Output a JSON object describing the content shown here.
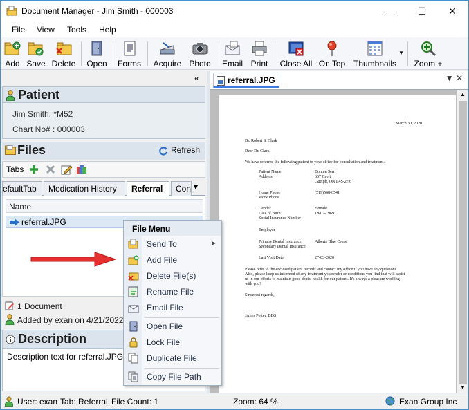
{
  "window": {
    "title": "Document Manager - Jim Smith - 000003",
    "controls": {
      "minimize": "—",
      "maximize": "☐",
      "close": "✕"
    }
  },
  "menu": [
    "File",
    "View",
    "Tools",
    "Help"
  ],
  "toolbar": {
    "add": "Add",
    "save": "Save",
    "delete": "Delete",
    "open": "Open",
    "forms": "Forms",
    "acquire": "Acquire",
    "photo": "Photo",
    "email": "Email",
    "print": "Print",
    "close_all": "Close All",
    "on_top": "On Top",
    "thumbnails": "Thumbnails",
    "zoom": "Zoom +"
  },
  "patient": {
    "header": "Patient",
    "name_line": "Jim Smith, *M52",
    "chart_line": "Chart No# : 000003"
  },
  "files": {
    "header": "Files",
    "refresh": "Refresh",
    "tabs_label": "Tabs",
    "tabs": [
      "efaultTab",
      "Medication History",
      "Referral",
      "Con"
    ],
    "column_name": "Name",
    "file": "referral.JPG",
    "doc_count": "1 Document",
    "added_by": "Added by exan on 4/21/2022"
  },
  "description": {
    "header": "Description",
    "text": "Description text for referral.JPG..."
  },
  "context_menu": {
    "title": "File Menu",
    "items": [
      "Send To",
      "Add File",
      "Delete File(s)",
      "Rename File",
      "Email File",
      "Open File",
      "Lock File",
      "Duplicate File",
      "Copy File Path"
    ]
  },
  "viewer": {
    "tab": "referral.JPG",
    "letter": {
      "date": "March 30, 2020",
      "to": "Dr. Robert S. Clark",
      "greeting": "Dear Dr. Clark,",
      "intro": "We have referred the following patient to your office for consultation and treatment.",
      "fields": [
        [
          "Patient Name",
          "Bonnie Serr"
        ],
        [
          "Address",
          "657 Croft"
        ],
        [
          "",
          "Guelph, ON  L4S-2H6"
        ],
        [
          "Home Phone",
          "(519)568-6541"
        ],
        [
          "Work Phone",
          ""
        ],
        [
          "Gender",
          "Female"
        ],
        [
          "Date of Birth",
          "19-02-1969"
        ],
        [
          "Social Insurance Number",
          ""
        ],
        [
          "Employer",
          ""
        ],
        [
          "Primary Dental Insurance",
          "Alberta Blue Cross"
        ],
        [
          "Secondary Dental Insurance",
          ""
        ],
        [
          "Last Visit Date",
          "27-03-2020"
        ]
      ],
      "body": [
        "Please refer to the enclosed patient records and contact my office if you have any questions.",
        "Also, please keep us informed of any treatment you render or conditions you find that will assist",
        "us in our efforts to maintain good dental health for our patient.  It's always a pleasure working",
        "with you!"
      ],
      "closing": "Sincerest regards,",
      "signature": "James Potter, DDS"
    }
  },
  "statusbar": {
    "user": "User: exan",
    "tab": "Tab:  Referral",
    "count": "File Count:  1",
    "zoom": "Zoom: 64 %",
    "company": "Exan Group Inc"
  }
}
